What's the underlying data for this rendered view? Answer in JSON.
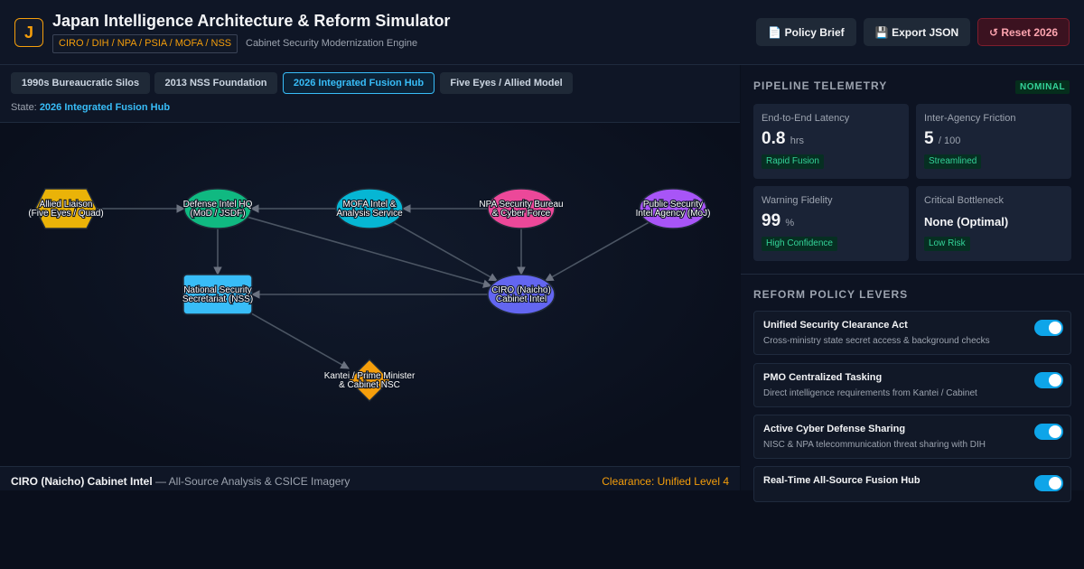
{
  "header": {
    "logo_letter": "J",
    "title": "Japan Intelligence Architecture & Reform Simulator",
    "agency_tag": "CIRO / DIH / NPA / PSIA / MOFA / NSS",
    "subtitle": "Cabinet Security Modernization Engine",
    "buttons": {
      "brief": "📄 Policy Brief",
      "export": "💾 Export JSON",
      "reset": "↺ Reset 2026"
    }
  },
  "eras": {
    "tabs": [
      {
        "label": "1990s Bureaucratic Silos",
        "active": false
      },
      {
        "label": "2013 NSS Foundation",
        "active": false
      },
      {
        "label": "2026 Integrated Fusion Hub",
        "active": true
      },
      {
        "label": "Five Eyes / Allied Model",
        "active": false
      }
    ],
    "state_prefix": "State:",
    "state_value": "2026 Integrated Fusion Hub"
  },
  "graph": {
    "nodes": [
      {
        "id": "allied",
        "line1": "Allied Liaison",
        "line2": "(Five Eyes / Quad)",
        "color": "#eab308",
        "shape": "hexagon"
      },
      {
        "id": "dih",
        "line1": "Defense Intel HQ",
        "line2": "(MoD / JSDF)",
        "color": "#10b981",
        "shape": "ellipse"
      },
      {
        "id": "mofa",
        "line1": "MOFA Intel &",
        "line2": "Analysis Service",
        "color": "#06b6d4",
        "shape": "ellipse"
      },
      {
        "id": "npa",
        "line1": "NPA Security Bureau",
        "line2": "& Cyber Force",
        "color": "#ec4899",
        "shape": "ellipse"
      },
      {
        "id": "psia",
        "line1": "Public Security",
        "line2": "Intel Agency (MoJ)",
        "color": "#a855f7",
        "shape": "ellipse"
      },
      {
        "id": "nss",
        "line1": "National Security",
        "line2": "Secretariat (NSS)",
        "color": "#38bdf8",
        "shape": "rect"
      },
      {
        "id": "ciro",
        "line1": "CIRO (Naicho)",
        "line2": "Cabinet Intel",
        "color": "#6366f1",
        "shape": "ellipse"
      },
      {
        "id": "kantei",
        "line1": "Kantei / Prime Minister",
        "line2": "& Cabinet NSC",
        "color": "#f59e0b",
        "shape": "diamond"
      }
    ],
    "edges": [
      [
        "allied",
        "dih"
      ],
      [
        "mofa",
        "dih"
      ],
      [
        "npa",
        "mofa"
      ],
      [
        "dih",
        "nss"
      ],
      [
        "dih",
        "ciro"
      ],
      [
        "mofa",
        "ciro"
      ],
      [
        "npa",
        "ciro"
      ],
      [
        "psia",
        "ciro"
      ],
      [
        "ciro",
        "nss"
      ],
      [
        "nss",
        "kantei"
      ]
    ]
  },
  "detail": {
    "name": "CIRO (Naicho) Cabinet Intel",
    "desc": "— All-Source Analysis & CSICE Imagery",
    "clearance": "Clearance: Unified Level 4"
  },
  "telemetry": {
    "title": "PIPELINE TELEMETRY",
    "status": "NOMINAL",
    "cards": [
      {
        "label": "End-to-End Latency",
        "value": "0.8",
        "unit": "hrs",
        "badge": "Rapid Fusion"
      },
      {
        "label": "Inter-Agency Friction",
        "value": "5",
        "unit": "/ 100",
        "badge": "Streamlined"
      },
      {
        "label": "Warning Fidelity",
        "value": "99",
        "unit": "%",
        "badge": "High Confidence"
      },
      {
        "label": "Critical Bottleneck",
        "value": "None (Optimal)",
        "unit": "",
        "badge": "Low Risk"
      }
    ]
  },
  "levers": {
    "title": "REFORM POLICY LEVERS",
    "items": [
      {
        "title": "Unified Security Clearance Act",
        "desc": "Cross-ministry state secret access & background checks",
        "on": true
      },
      {
        "title": "PMO Centralized Tasking",
        "desc": "Direct intelligence requirements from Kantei / Cabinet",
        "on": true
      },
      {
        "title": "Active Cyber Defense Sharing",
        "desc": "NISC & NPA telecommunication threat sharing with DIH",
        "on": true
      },
      {
        "title": "Real-Time All-Source Fusion Hub",
        "desc": "",
        "on": true
      }
    ]
  }
}
